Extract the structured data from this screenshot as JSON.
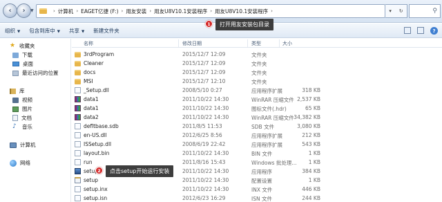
{
  "address_bar": {
    "crumbs": [
      "计算机",
      "EAGET亿捷 (F:)",
      "用友安装",
      "用友U8V10.1安装程序",
      "用友U8V10.1安装程序"
    ]
  },
  "toolbar": {
    "organize": "组织",
    "include_in_library": "包含到库中",
    "share": "共享",
    "new_folder": "新建文件夹"
  },
  "nav_pane": {
    "favorites": "收藏夹",
    "downloads": "下载",
    "desktop": "桌面",
    "recent": "最近访问的位置",
    "libraries": "库",
    "videos": "视频",
    "pictures": "图片",
    "documents": "文档",
    "music": "音乐",
    "computer": "计算机",
    "network": "网络"
  },
  "columns": {
    "name": "名称",
    "date": "修改日期",
    "type": "类型",
    "size": "大小"
  },
  "files": [
    {
      "name": "3rdProgram",
      "date": "2015/12/7 12:09",
      "type": "文件夹",
      "size": "",
      "icon": "folder"
    },
    {
      "name": "Cleaner",
      "date": "2015/12/7 12:09",
      "type": "文件夹",
      "size": "",
      "icon": "folder"
    },
    {
      "name": "docs",
      "date": "2015/12/7 12:09",
      "type": "文件夹",
      "size": "",
      "icon": "folder"
    },
    {
      "name": "MSI",
      "date": "2015/12/7 12:10",
      "type": "文件夹",
      "size": "",
      "icon": "folder"
    },
    {
      "name": "_Setup.dll",
      "date": "2008/5/10 0:27",
      "type": "应用程序扩展",
      "size": "318 KB",
      "icon": "file"
    },
    {
      "name": "data1",
      "date": "2011/10/22 14:30",
      "type": "WinRAR 压缩文件",
      "size": "2,537 KB",
      "icon": "rar"
    },
    {
      "name": "data1",
      "date": "2011/10/22 14:30",
      "type": "图标文件(.hdr)",
      "size": "65 KB",
      "icon": "rar"
    },
    {
      "name": "data2",
      "date": "2011/10/22 14:30",
      "type": "WinRAR 压缩文件",
      "size": "34,382 KB",
      "icon": "rar"
    },
    {
      "name": "defltbase.sdb",
      "date": "2011/8/5 11:53",
      "type": "SDB 文件",
      "size": "3,080 KB",
      "icon": "file"
    },
    {
      "name": "en-US.dll",
      "date": "2012/6/25 8:56",
      "type": "应用程序扩展",
      "size": "212 KB",
      "icon": "file"
    },
    {
      "name": "ISSetup.dll",
      "date": "2008/6/19 22:42",
      "type": "应用程序扩展",
      "size": "543 KB",
      "icon": "file"
    },
    {
      "name": "layout.bin",
      "date": "2011/10/22 14:30",
      "type": "BIN 文件",
      "size": "1 KB",
      "icon": "file"
    },
    {
      "name": "run",
      "date": "2011/8/16 15:43",
      "type": "Windows 批处理...",
      "size": "1 KB",
      "icon": "file"
    },
    {
      "name": "setup",
      "date": "2011/10/22 14:30",
      "type": "应用程序",
      "size": "384 KB",
      "icon": "setup"
    },
    {
      "name": "setup",
      "date": "2011/10/22 14:30",
      "type": "配置设置",
      "size": "1 KB",
      "icon": "ini"
    },
    {
      "name": "setup.inx",
      "date": "2011/10/22 14:30",
      "type": "INX 文件",
      "size": "446 KB",
      "icon": "file"
    },
    {
      "name": "setup.isn",
      "date": "2012/6/23 16:29",
      "type": "ISN 文件",
      "size": "244 KB",
      "icon": "file"
    }
  ],
  "annotations": {
    "step1_number": "1",
    "step1_text": "打开用友安装包目录",
    "step2_number": "2",
    "step2_text": "点击setup开始运行安装"
  },
  "colors": {
    "badge": "#d42626",
    "callout_bg": "#3d3d3d"
  }
}
